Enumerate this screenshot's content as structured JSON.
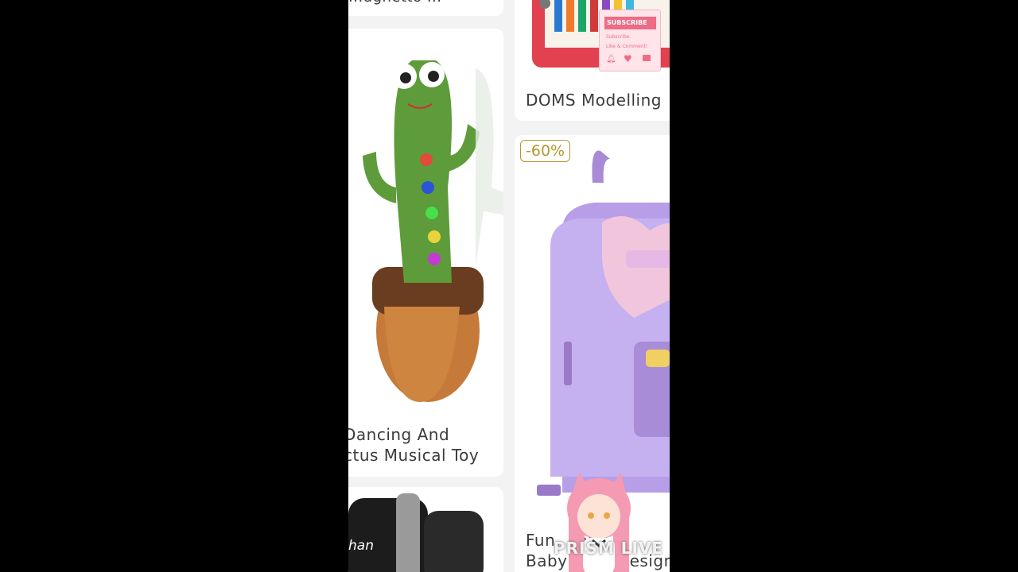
{
  "products": [
    {
      "title_visible": "...ughetto ..."
    },
    {
      "title_visible": "DOMS Modelling"
    },
    {
      "line1": "Dancing And",
      "line2": "ctus Musical Toy"
    },
    {
      "badge": "-60%",
      "line1": "Fun... ppy T",
      "line2": "Baby Bear Design"
    },
    {
      "watch_text": "han"
    }
  ],
  "overlay": {
    "subscribe_btn": "SUBSCRIBE",
    "subscribe_text": "Subscribe",
    "like_comment": "Like & Comment!",
    "watermark": "PRISM LIVE"
  },
  "colors": {
    "badge": "#b8962e",
    "subscribe": "#ef6b86"
  }
}
